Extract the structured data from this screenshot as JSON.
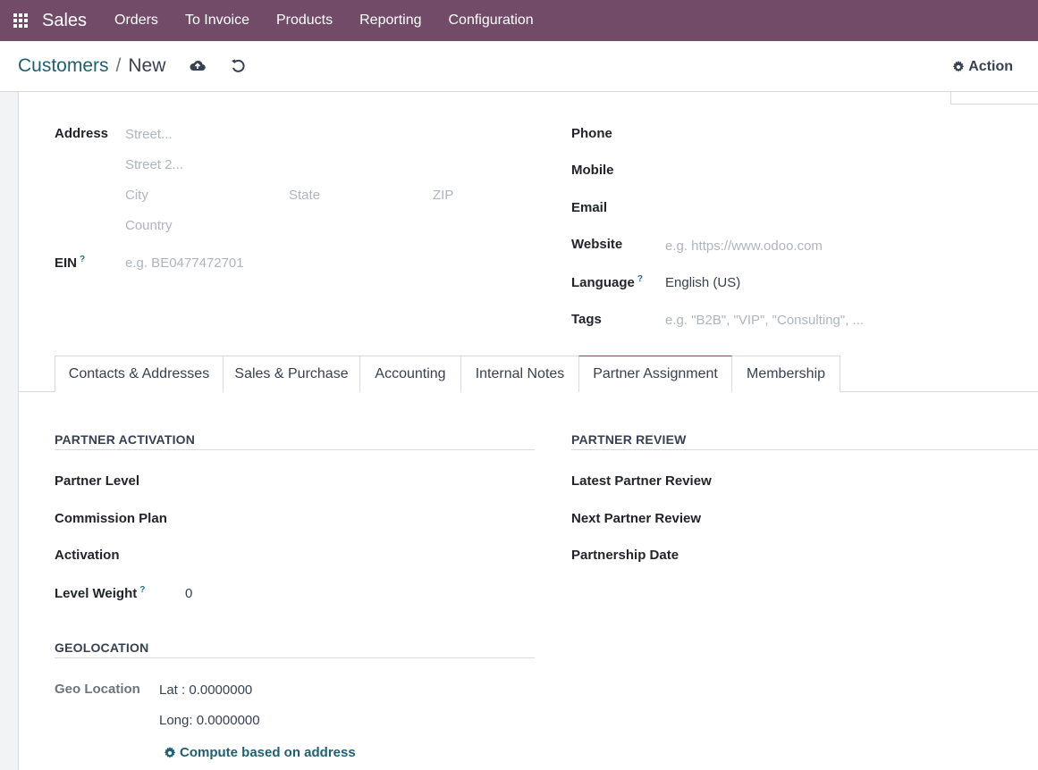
{
  "navbar": {
    "app_name": "Sales",
    "menu": [
      "Orders",
      "To Invoice",
      "Products",
      "Reporting",
      "Configuration"
    ]
  },
  "breadcrumb": {
    "parent": "Customers",
    "separator": "/",
    "current": "New"
  },
  "control_panel": {
    "action_label": "Action"
  },
  "form": {
    "address": {
      "label": "Address",
      "street_placeholder": "Street...",
      "street2_placeholder": "Street 2...",
      "city_placeholder": "City",
      "state_placeholder": "State",
      "zip_placeholder": "ZIP",
      "country_placeholder": "Country"
    },
    "ein": {
      "label": "EIN",
      "help": "?",
      "placeholder": "e.g. BE0477472701"
    },
    "phone": {
      "label": "Phone"
    },
    "mobile": {
      "label": "Mobile"
    },
    "email": {
      "label": "Email"
    },
    "website": {
      "label": "Website",
      "placeholder": "e.g. https://www.odoo.com"
    },
    "language": {
      "label": "Language",
      "help": "?",
      "value": "English (US)"
    },
    "tags": {
      "label": "Tags",
      "placeholder": "e.g. \"B2B\", \"VIP\", \"Consulting\", ..."
    }
  },
  "tabs": [
    {
      "label": "Contacts & Addresses",
      "active": false
    },
    {
      "label": "Sales & Purchase",
      "active": false
    },
    {
      "label": "Accounting",
      "active": false
    },
    {
      "label": "Internal Notes",
      "active": false
    },
    {
      "label": "Partner Assignment",
      "active": true
    },
    {
      "label": "Membership",
      "active": false
    }
  ],
  "partner_activation": {
    "title": "PARTNER ACTIVATION",
    "partner_level": "Partner Level",
    "commission_plan": "Commission Plan",
    "activation": "Activation",
    "level_weight": "Level Weight",
    "level_weight_help": "?",
    "level_weight_value": "0"
  },
  "partner_review": {
    "title": "PARTNER REVIEW",
    "latest": "Latest Partner Review",
    "next": "Next Partner Review",
    "date": "Partnership Date"
  },
  "geolocation": {
    "title": "GEOLOCATION",
    "label": "Geo Location",
    "lat": "Lat : 0.0000000",
    "long": "Long: 0.0000000",
    "compute_label": "Compute based on address"
  },
  "colors": {
    "navbar": "#714b67",
    "link": "#1f5f72",
    "placeholder": "#adb5bd",
    "border": "#d8dadd"
  }
}
